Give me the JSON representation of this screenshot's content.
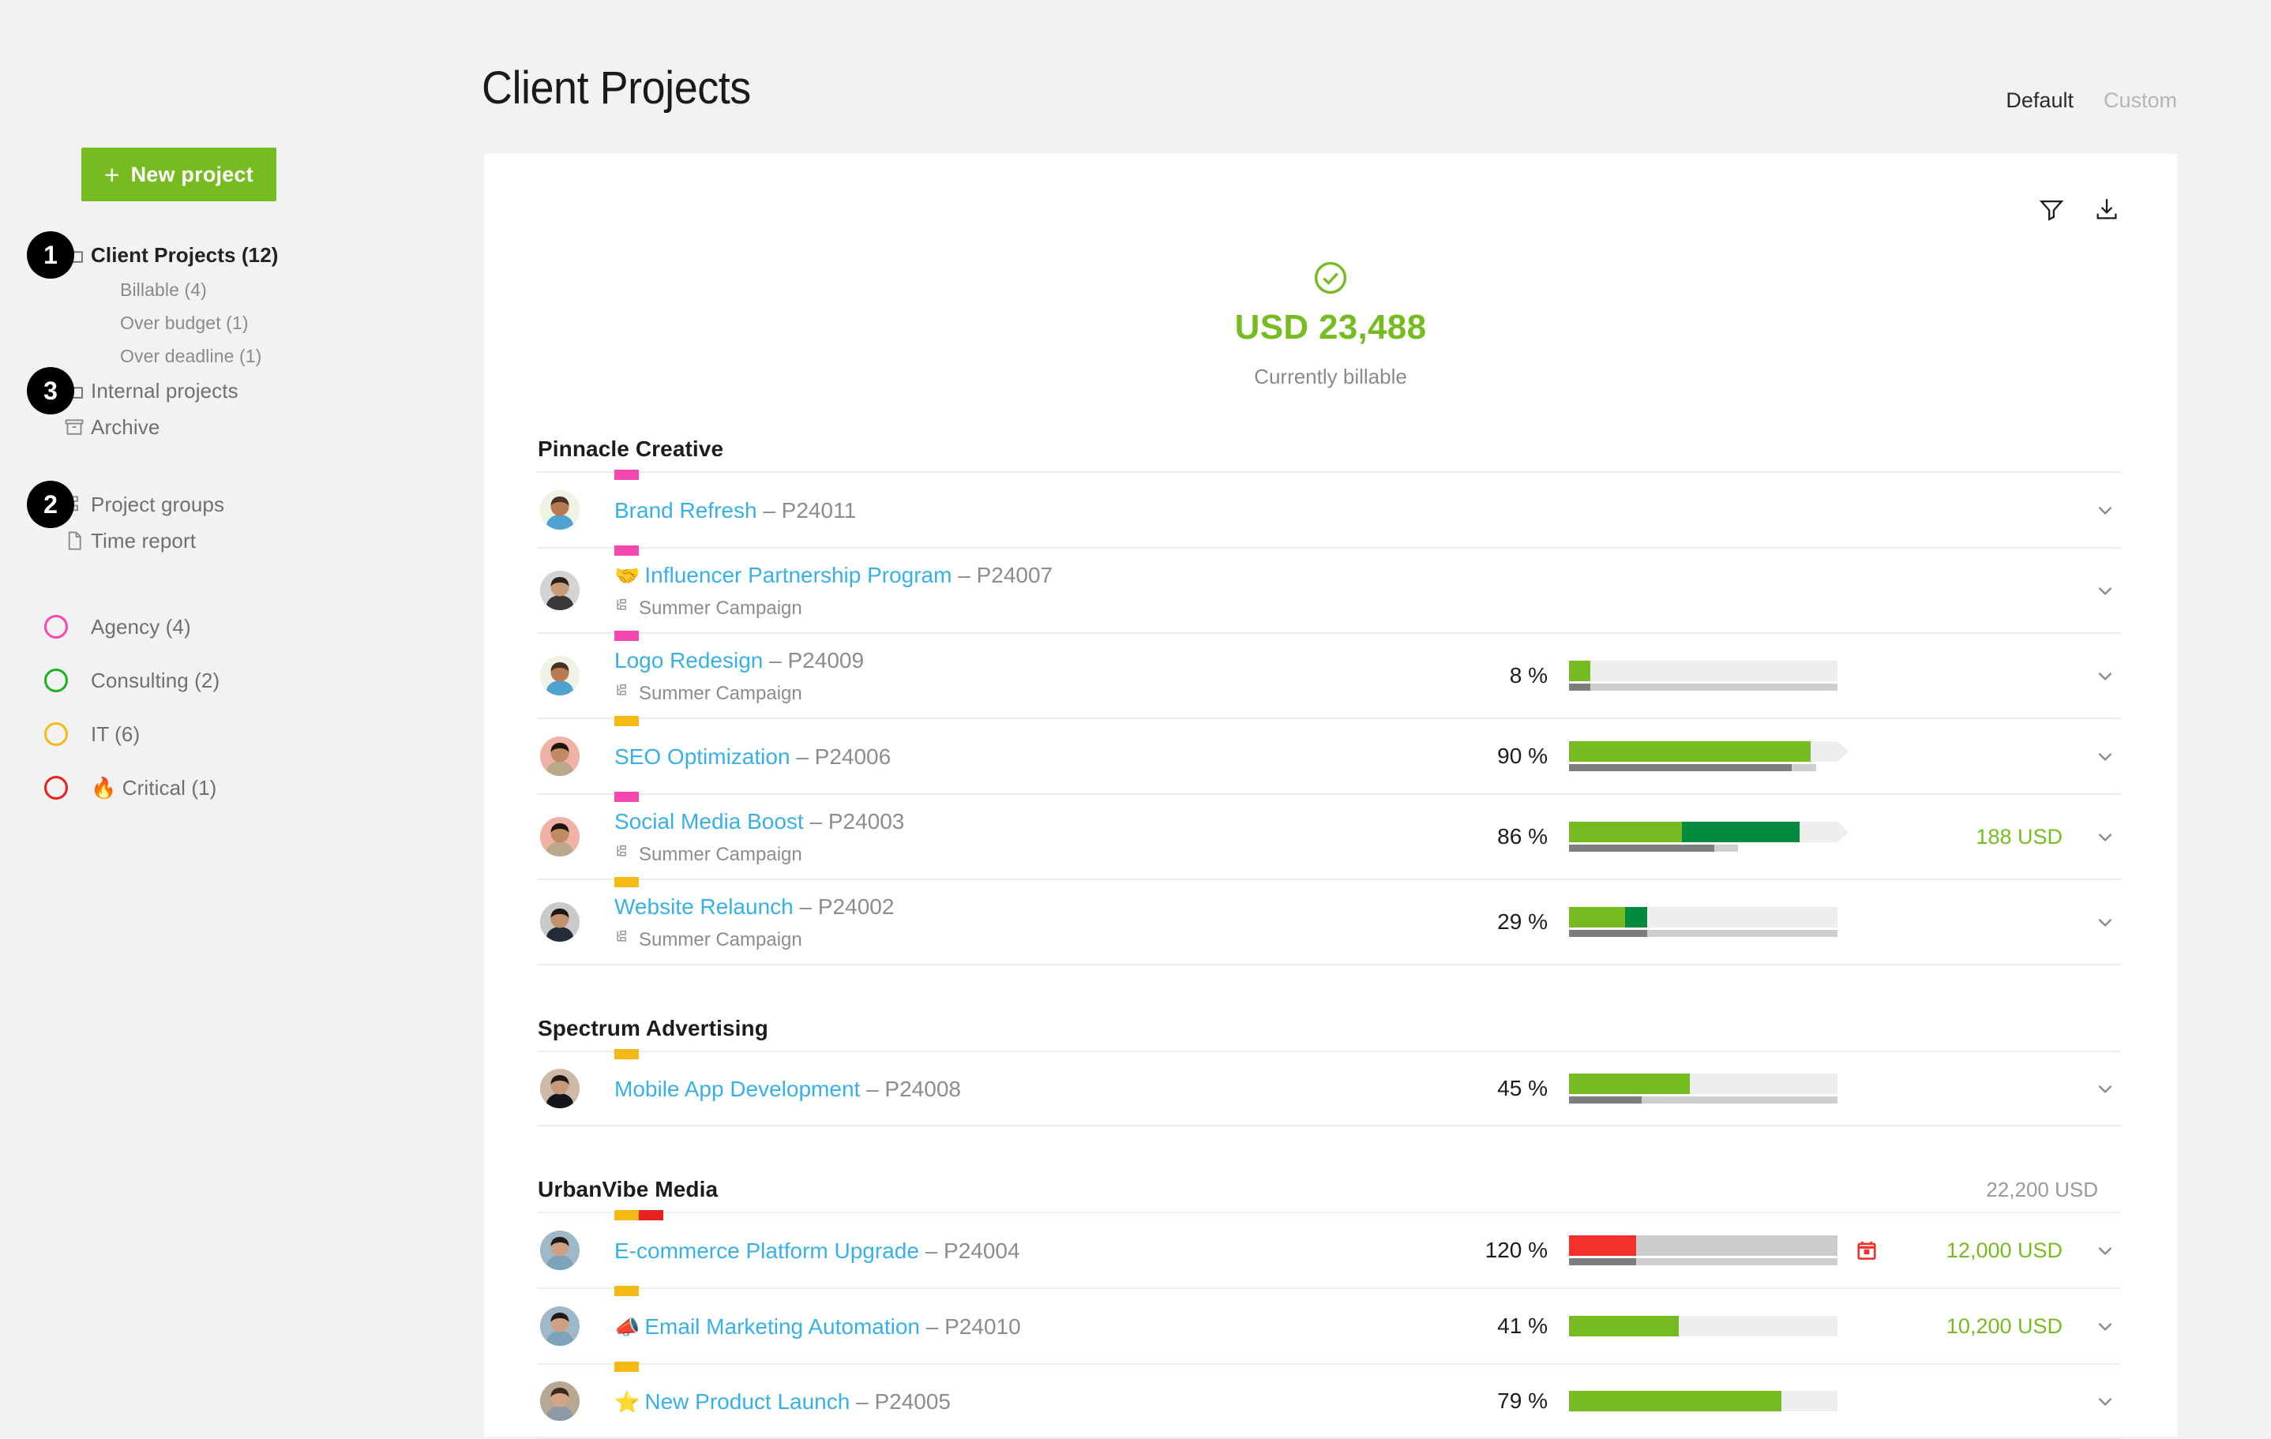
{
  "header": {
    "title": "Client Projects",
    "tabs": [
      {
        "label": "Default",
        "selected": true
      },
      {
        "label": "Custom",
        "selected": false
      }
    ]
  },
  "sidebar": {
    "new_project_label": "New project",
    "new_project_icon": "plus-icon",
    "nav": [
      {
        "label": "Client Projects (12)",
        "icon": "folder-icon",
        "badge": "1",
        "active": true,
        "sub": false
      },
      {
        "label": "Billable (4)",
        "icon": "",
        "badge": "",
        "active": false,
        "sub": true
      },
      {
        "label": "Over budget (1)",
        "icon": "",
        "badge": "",
        "active": false,
        "sub": true
      },
      {
        "label": "Over deadline (1)",
        "icon": "",
        "badge": "",
        "active": false,
        "sub": true
      },
      {
        "label": "Internal projects",
        "icon": "folder-icon",
        "badge": "3",
        "active": false,
        "sub": false
      },
      {
        "label": "Archive",
        "icon": "archive-icon",
        "badge": "",
        "active": false,
        "sub": false
      },
      {
        "label": "Project groups",
        "icon": "project-groups-icon",
        "badge": "2",
        "active": false,
        "sub": false
      },
      {
        "label": "Time report",
        "icon": "document-icon",
        "badge": "",
        "active": false,
        "sub": false
      }
    ],
    "groups": [
      {
        "label": "Agency (4)",
        "color": "#f549b0",
        "emoji": ""
      },
      {
        "label": "Consulting (2)",
        "color": "#19b319",
        "emoji": ""
      },
      {
        "label": "IT (6)",
        "color": "#f5b916",
        "emoji": ""
      },
      {
        "label": "Critical (1)",
        "color": "#e8201f",
        "emoji": "🔥"
      }
    ]
  },
  "card": {
    "tools": [
      {
        "name": "filter-icon",
        "label": "Filter"
      },
      {
        "name": "download-icon",
        "label": "Export"
      }
    ],
    "summary": {
      "icon": "check-circle-icon",
      "amount": "USD 23,488",
      "caption": "Currently billable",
      "color": "#76bc21"
    },
    "clients": [
      {
        "name": "Pinnacle Creative",
        "total": "",
        "projects": [
          {
            "title": "Brand Refresh",
            "id": "– P24011",
            "emoji": "",
            "group": "",
            "percent": "",
            "bar": null,
            "money": "",
            "warning": "",
            "colors": [
              "#f549b0"
            ]
          },
          {
            "title": "Influencer Partnership Program",
            "id": "– P24007",
            "emoji": "🤝",
            "group": "Summer Campaign",
            "percent": "",
            "bar": null,
            "money": "",
            "warning": "",
            "colors": [
              "#f549b0"
            ]
          },
          {
            "title": "Logo Redesign",
            "id": "– P24009",
            "emoji": "",
            "group": "Summer Campaign",
            "percent": "8 %",
            "bar": {
              "light": 8,
              "dark": 0,
              "sub": 100,
              "over": false,
              "arrow": false
            },
            "money": "",
            "warning": "",
            "colors": [
              "#f549b0"
            ]
          },
          {
            "title": "SEO Optimization",
            "id": "– P24006",
            "emoji": "",
            "group": "",
            "percent": "90 %",
            "bar": {
              "light": 90,
              "dark": 0,
              "sub": 92,
              "over": false,
              "arrow": true
            },
            "money": "",
            "warning": "",
            "colors": [
              "#f5b916"
            ]
          },
          {
            "title": "Social Media Boost",
            "id": "– P24003",
            "emoji": "",
            "group": "Summer Campaign",
            "percent": "86 %",
            "bar": {
              "light": 42,
              "dark": 44,
              "sub": 63,
              "over": false,
              "arrow": true
            },
            "money": "188 USD",
            "warning": "",
            "colors": [
              "#f549b0"
            ]
          },
          {
            "title": "Website Relaunch",
            "id": "– P24002",
            "emoji": "",
            "group": "Summer Campaign",
            "percent": "29 %",
            "bar": {
              "light": 21,
              "dark": 8,
              "sub": 100,
              "over": false,
              "arrow": false
            },
            "money": "",
            "warning": "",
            "colors": [
              "#f5b916"
            ]
          }
        ]
      },
      {
        "name": "Spectrum Advertising",
        "total": "",
        "projects": [
          {
            "title": "Mobile App Development",
            "id": "– P24008",
            "emoji": "",
            "group": "",
            "percent": "45 %",
            "bar": {
              "light": 45,
              "dark": 0,
              "sub": 100,
              "subdark": 27,
              "over": false,
              "arrow": false
            },
            "money": "",
            "warning": "",
            "colors": [
              "#f5b916"
            ]
          }
        ]
      },
      {
        "name": "UrbanVibe Media",
        "total": "22,200 USD",
        "projects": [
          {
            "title": "E-commerce Platform Upgrade",
            "id": "– P24004",
            "emoji": "",
            "group": "",
            "percent": "120 %",
            "bar": {
              "light": 0,
              "dark": 0,
              "red": 25,
              "sub": 100,
              "over": true,
              "arrow": false
            },
            "money": "12,000 USD",
            "warning": "calendar-alert-icon",
            "colors": [
              "#f5b916",
              "#e8201f"
            ]
          },
          {
            "title": "Email Marketing Automation",
            "id": "– P24010",
            "emoji": "📣",
            "group": "",
            "percent": "41 %",
            "bar": {
              "light": 41,
              "dark": 0,
              "sub": 0,
              "over": false,
              "arrow": false
            },
            "money": "10,200 USD",
            "warning": "",
            "colors": [
              "#f5b916"
            ]
          },
          {
            "title": "New Product Launch",
            "id": "– P24005",
            "emoji": "⭐",
            "group": "",
            "percent": "79 %",
            "bar": {
              "light": 79,
              "dark": 0,
              "sub": 0,
              "over": false,
              "arrow": false
            },
            "money": "",
            "warning": "",
            "colors": [
              "#f5b916"
            ]
          }
        ]
      }
    ]
  },
  "colors": {
    "brand_green": "#76bc21",
    "link_blue": "#37b0e9",
    "bar_light_green": "#76bc21",
    "bar_dark_green": "#008a3e",
    "bar_red": "#f4302b",
    "track": "#eeeeee",
    "track_over": "#cccccc"
  }
}
